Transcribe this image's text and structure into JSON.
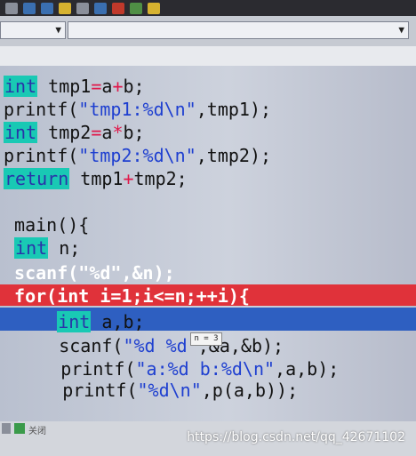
{
  "lines": [
    {
      "parts": [
        {
          "t": "int",
          "c": "kw"
        },
        {
          "t": " tmp1",
          "c": "plain"
        },
        {
          "t": "=",
          "c": "op"
        },
        {
          "t": "a",
          "c": "plain"
        },
        {
          "t": "+",
          "c": "op"
        },
        {
          "t": "b;",
          "c": "plain"
        }
      ]
    },
    {
      "parts": [
        {
          "t": "printf(",
          "c": "plain"
        },
        {
          "t": "\"tmp1:%d\\n\"",
          "c": "str"
        },
        {
          "t": ",tmp1);",
          "c": "plain"
        }
      ]
    },
    {
      "parts": [
        {
          "t": "int",
          "c": "kw"
        },
        {
          "t": " tmp2",
          "c": "plain"
        },
        {
          "t": "=",
          "c": "op"
        },
        {
          "t": "a",
          "c": "plain"
        },
        {
          "t": "*",
          "c": "op"
        },
        {
          "t": "b;",
          "c": "plain"
        }
      ]
    },
    {
      "parts": [
        {
          "t": "printf(",
          "c": "plain"
        },
        {
          "t": "\"tmp2:%d\\n\"",
          "c": "str"
        },
        {
          "t": ",tmp2);",
          "c": "plain"
        }
      ]
    },
    {
      "parts": [
        {
          "t": "return",
          "c": "kw"
        },
        {
          "t": " tmp1",
          "c": "plain"
        },
        {
          "t": "+",
          "c": "op"
        },
        {
          "t": "tmp2;",
          "c": "plain"
        }
      ]
    },
    {
      "parts": []
    },
    {
      "parts": [
        {
          "t": " main(){",
          "c": "plain"
        }
      ]
    },
    {
      "parts": [
        {
          "t": " ",
          "c": "plain"
        },
        {
          "t": "int",
          "c": "kw"
        },
        {
          "t": " n;",
          "c": "plain"
        }
      ]
    },
    {
      "parts": [
        {
          "t": " scanf(\"%d\",&n);",
          "c": "white"
        }
      ]
    },
    {
      "parts": [
        {
          "t": " for(int i=1;i<=n;++i){",
          "c": "white"
        }
      ]
    },
    {
      "parts": [
        {
          "t": "     ",
          "c": "plain"
        },
        {
          "t": "int",
          "c": "kw"
        },
        {
          "t": " a,b;",
          "c": "plain"
        }
      ]
    },
    {
      "parts": [
        {
          "t": "     scanf(",
          "c": "plain"
        },
        {
          "t": "\"%d %d\"",
          "c": "str"
        },
        {
          "t": ",&a,&b);",
          "c": "plain"
        }
      ]
    },
    {
      "parts": [
        {
          "t": "     printf(",
          "c": "plain"
        },
        {
          "t": "\"a:%d b:%d\\n\"",
          "c": "str"
        },
        {
          "t": ",a,b);",
          "c": "plain"
        }
      ]
    },
    {
      "parts": [
        {
          "t": "     printf(",
          "c": "plain"
        },
        {
          "t": "\"%d\\n\"",
          "c": "str"
        },
        {
          "t": ",p(a,b));",
          "c": "plain"
        }
      ]
    }
  ],
  "tooltip": "n = 3",
  "bottom_tab_text": "关闭",
  "watermark": "https://blog.csdn.net/qq_42671102"
}
